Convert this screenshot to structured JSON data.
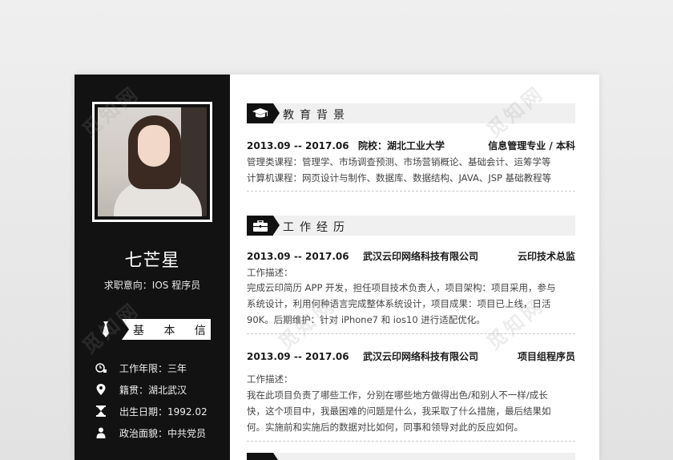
{
  "resume": {
    "name": "七芒星",
    "intent": "求职意向：IOS 程序员",
    "basic": {
      "title": "基 本 信",
      "rows": [
        {
          "icon": "clock-icon",
          "text": "工作年限：三年"
        },
        {
          "icon": "location-pin-icon",
          "text": "籍贯：湖北武汉"
        },
        {
          "icon": "hourglass-icon",
          "text": "出生日期：1992.02"
        },
        {
          "icon": "person-icon",
          "text": "政治面貌：中共党员"
        }
      ]
    },
    "education": {
      "title": "教育背景",
      "icon": "graduation-cap-icon",
      "period": "2013.09 -- 2017.06",
      "school": "院校：湖北工业大学",
      "major": "信息管理专业 / 本科",
      "lines": [
        "管理类课程：管理学、市场调查预测、市场营销概论、基础会计、运筹学等",
        "计算机课程：网页设计与制作、数据库、数据结构、JAVA、JSP 基础教程等"
      ]
    },
    "work": {
      "title": "工作经历",
      "icon": "briefcase-icon",
      "jobs": [
        {
          "period": "2013.09 -- 2017.06",
          "company": "武汉云印网络科技有限公司",
          "role": "云印技术总监",
          "lines": [
            "工作描述：",
            "完成云印简历 APP 开发，担任项目技术负责人，项目架构：项目采用，参与",
            "系统设计，利用何种语言完成整体系统设计，项目成果：项目已上线，日活",
            "90K。后期维护：针对 iPhone7 和 ios10 进行适配优化。"
          ]
        },
        {
          "period": "2013.09 -- 2017.06",
          "company": "武汉云印网络科技有限公司",
          "role": "项目组程序员",
          "lines": [
            "工作描述：",
            "我在此项目负责了哪些工作，分别在哪些地方做得出色/和别人不一样/成长",
            "快，这个项目中，我最困难的问题是什么，我采取了什么措施，最后结果如",
            "何。实施前和实施后的数据对比如何，同事和领导对此的反应如何。"
          ]
        }
      ]
    }
  },
  "watermark": "觅知网",
  "colors": {
    "sidebar": "#121212",
    "accent": "#111111",
    "section_bg": "#f0f0f0"
  }
}
